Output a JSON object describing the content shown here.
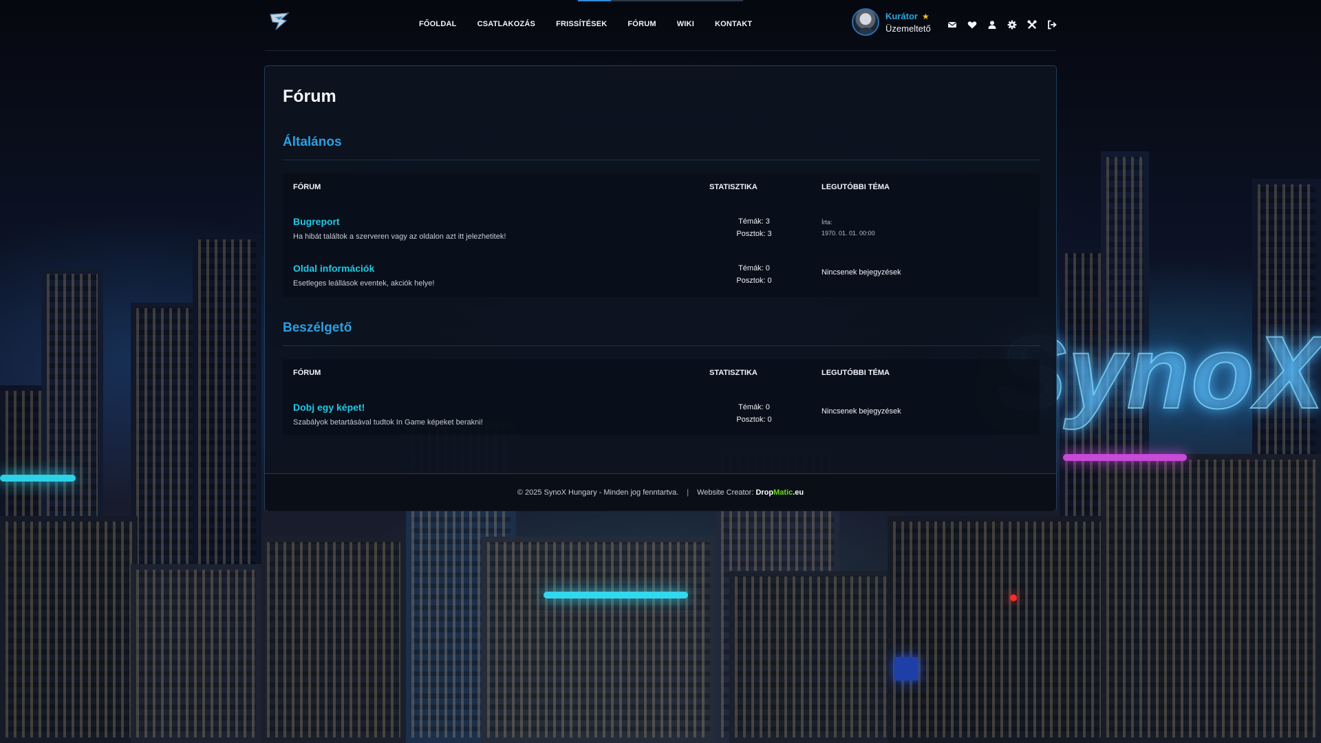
{
  "colors": {
    "accent": "#2c9fe0",
    "forum_link": "#1fc9e6",
    "user_name": "#29a6e0",
    "star": "#f2c230",
    "credit_green": "#63e01b"
  },
  "header": {
    "logo": "synox-logo",
    "nav": [
      "FŐOLDAL",
      "CSATLAKOZÁS",
      "FRISSÍTÉSEK",
      "FÓRUM",
      "WIKI",
      "KONTAKT"
    ],
    "user": {
      "name": "Kurátor",
      "star": "★",
      "role": "Üzemeltető"
    },
    "icons": [
      "envelope-icon",
      "heart-icon",
      "user-icon",
      "gear-icon",
      "tools-icon",
      "logout-icon"
    ]
  },
  "page": {
    "title": "Fórum"
  },
  "sections": [
    {
      "title": "Általános",
      "headers": {
        "forum": "FÓRUM",
        "stats": "STATISZTIKA",
        "latest": "LEGUTÓBBI TÉMA"
      },
      "rows": [
        {
          "title": "Bugreport",
          "description": "Ha hibát találtok a szerveren vagy az oldalon azt itt jelezhetitek!",
          "topics": "Témák: 3",
          "posts": "Posztok: 3",
          "latest_by": "Írta:",
          "latest_date": "1970. 01. 01. 00:00"
        },
        {
          "title": "Oldal információk",
          "description": "Esetleges leállások eventek, akciók helye!",
          "topics": "Témák: 0",
          "posts": "Posztok: 0",
          "latest": "Nincsenek bejegyzések"
        }
      ]
    },
    {
      "title": "Beszélgető",
      "headers": {
        "forum": "FÓRUM",
        "stats": "STATISZTIKA",
        "latest": "LEGUTÓBBI TÉMA"
      },
      "rows": [
        {
          "title": "Dobj egy képet!",
          "description": "Szabályok betartásával tudtok In Game képeket berakni!",
          "topics": "Témák: 0",
          "posts": "Posztok: 0",
          "latest": "Nincsenek bejegyzések"
        }
      ]
    }
  ],
  "footer": {
    "copyright": "© 2025 SynoX Hungary - Minden jog fenntartva.",
    "separator": "|",
    "creator_label": "Website Creator:",
    "creator_part1": "Drop",
    "creator_part2": "Matic",
    "creator_part3": ".eu"
  },
  "background": {
    "sign_text": "SynoX"
  }
}
